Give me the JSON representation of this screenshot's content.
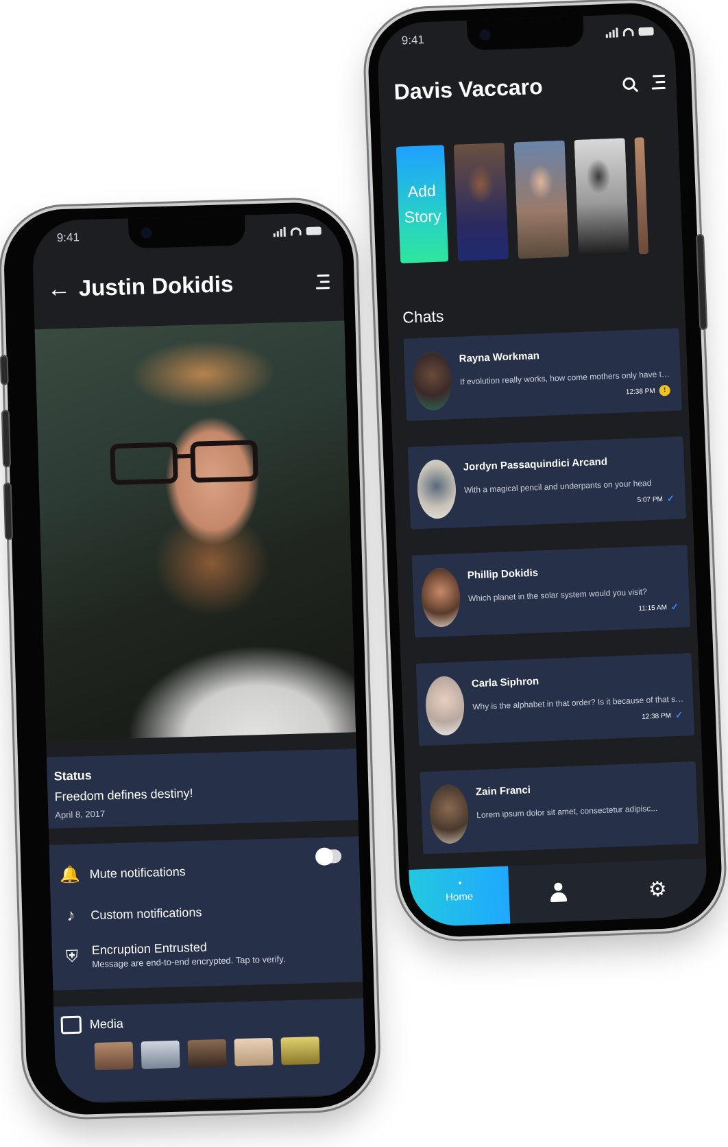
{
  "left_phone": {
    "status_time": "9:41",
    "header": {
      "title": "Justin Dokidis"
    },
    "status": {
      "title": "Status",
      "text": "Freedom defines destiny!",
      "date": "April 8, 2017"
    },
    "settings": [
      {
        "icon": "bell-icon",
        "label": "Mute notifications",
        "toggle_on": false
      },
      {
        "icon": "music-note-icon",
        "label": "Custom notifications"
      },
      {
        "icon": "shield-check-icon",
        "label": "Encruption Entrusted",
        "sublabel": "Message are end-to-end encrypted. Tap to verify."
      }
    ],
    "media": {
      "label": "Media",
      "icon": "image-icon"
    }
  },
  "right_phone": {
    "status_time": "9:41",
    "header": {
      "title": "Davis Vaccaro"
    },
    "add_story": {
      "line1": "Add",
      "line2": "Story"
    },
    "chats_title": "Chats",
    "chats": [
      {
        "name": "Rayna Workman",
        "message": "If evolution really works, how come mothers only have two...",
        "time": "12:38 PM",
        "unread": "!"
      },
      {
        "name": "Jordyn Passaquindici Arcand",
        "message": "With a magical pencil and underpants on your head",
        "time": "5:07 PM"
      },
      {
        "name": "Phillip Dokidis",
        "message": "Which planet in the solar system would you visit?",
        "time": "11:15 AM"
      },
      {
        "name": "Carla Siphron",
        "message": "Why is the alphabet in that order? Is it because of that song...",
        "time": "12:38 PM"
      },
      {
        "name": "Zain Franci",
        "message": "Lorem ipsum dolor sit amet, consectetur adipisc...",
        "time": ""
      }
    ],
    "tabs": {
      "home": "Home"
    },
    "colors": {
      "card": "#263149",
      "background": "#1c1e22",
      "accent": "#20a8ff",
      "unread_badge": "#f1c21b"
    }
  }
}
